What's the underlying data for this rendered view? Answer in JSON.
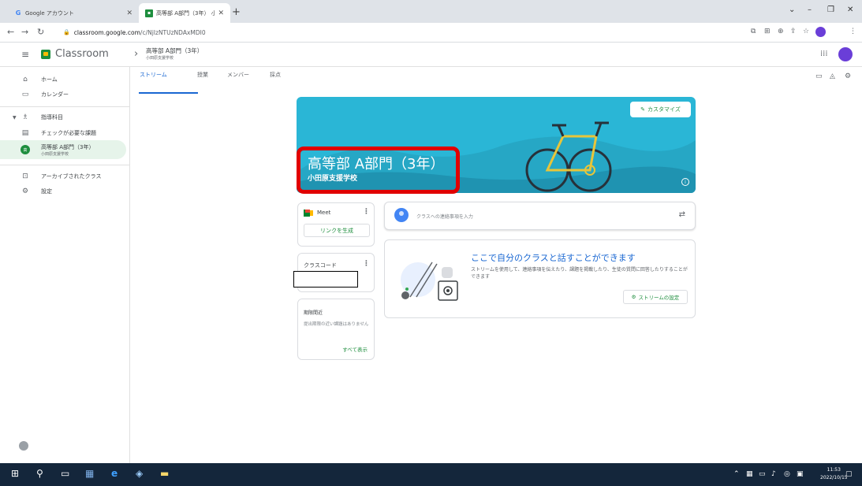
{
  "browser": {
    "tabs": [
      {
        "label": "Google アカウント",
        "active": false
      },
      {
        "label": "高等部 A部門（3年） 小田原支…",
        "active": true
      }
    ],
    "url_host": "classroom.google.com",
    "url_path": "/c/NjIzNTUzNDAxMDI0"
  },
  "app": {
    "name": "Classroom",
    "class_title": "高等部 A部門（3年）",
    "class_subtitle": "小田原支援学校"
  },
  "sidebar": {
    "home": "ホーム",
    "calendar": "カレンダー",
    "teaching": "指導科目",
    "review": "チェックが必要な課題",
    "class_name": "高等部 A部門（3年）",
    "class_school": "小田原支援学校",
    "archived": "アーカイブされたクラス",
    "settings": "設定"
  },
  "tabs": {
    "stream": "ストリーム",
    "classwork": "授業",
    "people": "メンバー",
    "grades": "採点"
  },
  "banner": {
    "customize": "カスタマイズ",
    "title": "高等部 A部門（3年）",
    "subtitle": "小田原支援学校"
  },
  "meet": {
    "label": "Meet",
    "generate_link": "リンクを生成"
  },
  "class_code": {
    "label": "クラスコード"
  },
  "upcoming": {
    "title": "期限間近",
    "body": "提出期限の近い課題はありません",
    "view_all": "すべて表示"
  },
  "post": {
    "placeholder": "クラスへの連絡事項を入力"
  },
  "talk": {
    "title": "ここで自分のクラスと話すことができます",
    "body": "ストリームを使用して、連絡事項を伝えたり、課題を掲載したり、生徒の質問に回答したりすることができます",
    "settings": "ストリームの設定"
  },
  "taskbar": {
    "time": "11:53",
    "date": "2022/10/15"
  },
  "colors": {
    "accent_green": "#1e8e3e",
    "banner": "#2ab6d6",
    "highlight_box": "#e10000"
  }
}
